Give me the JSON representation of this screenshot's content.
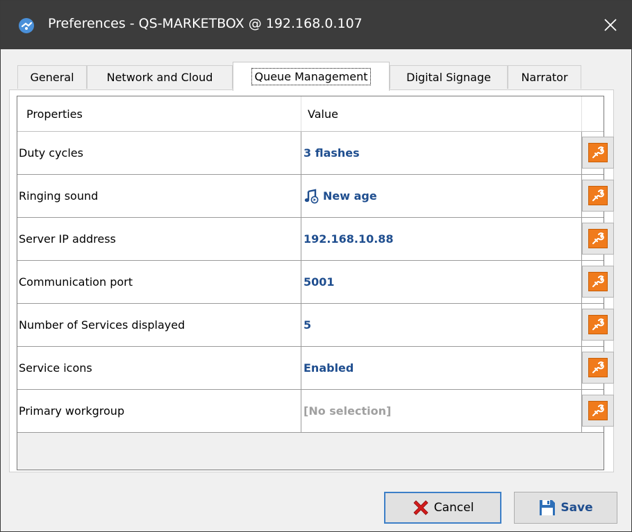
{
  "window": {
    "title": "Preferences - QS-MARKETBOX @ 192.168.0.107",
    "close_icon": "close-icon",
    "titlebar_color": "#3c3c3c"
  },
  "tabs": [
    {
      "label": "General",
      "active": false
    },
    {
      "label": "Network and Cloud",
      "active": false
    },
    {
      "label": "Queue Management",
      "active": true
    },
    {
      "label": "Digital Signage",
      "active": false
    },
    {
      "label": "Narrator",
      "active": false
    }
  ],
  "grid": {
    "columns": {
      "properties": "Properties",
      "value": "Value"
    },
    "rows": [
      {
        "property": "Duty cycles",
        "value": "3 flashes"
      },
      {
        "property": "Ringing sound",
        "value": "New age",
        "icon": "music-note-icon"
      },
      {
        "property": "Server IP address",
        "value": "192.168.10.88"
      },
      {
        "property": "Communication port",
        "value": "5001"
      },
      {
        "property": "Number of Services displayed",
        "value": "5"
      },
      {
        "property": "Service icons",
        "value": "Enabled"
      },
      {
        "property": "Primary workgroup",
        "value": "[No selection]",
        "muted": true
      }
    ],
    "action_icon": "wrench-icon",
    "value_color": "#1f4e8f",
    "action_color": "#f07b1c"
  },
  "buttons": {
    "cancel_label": "Cancel",
    "save_label": "Save"
  }
}
